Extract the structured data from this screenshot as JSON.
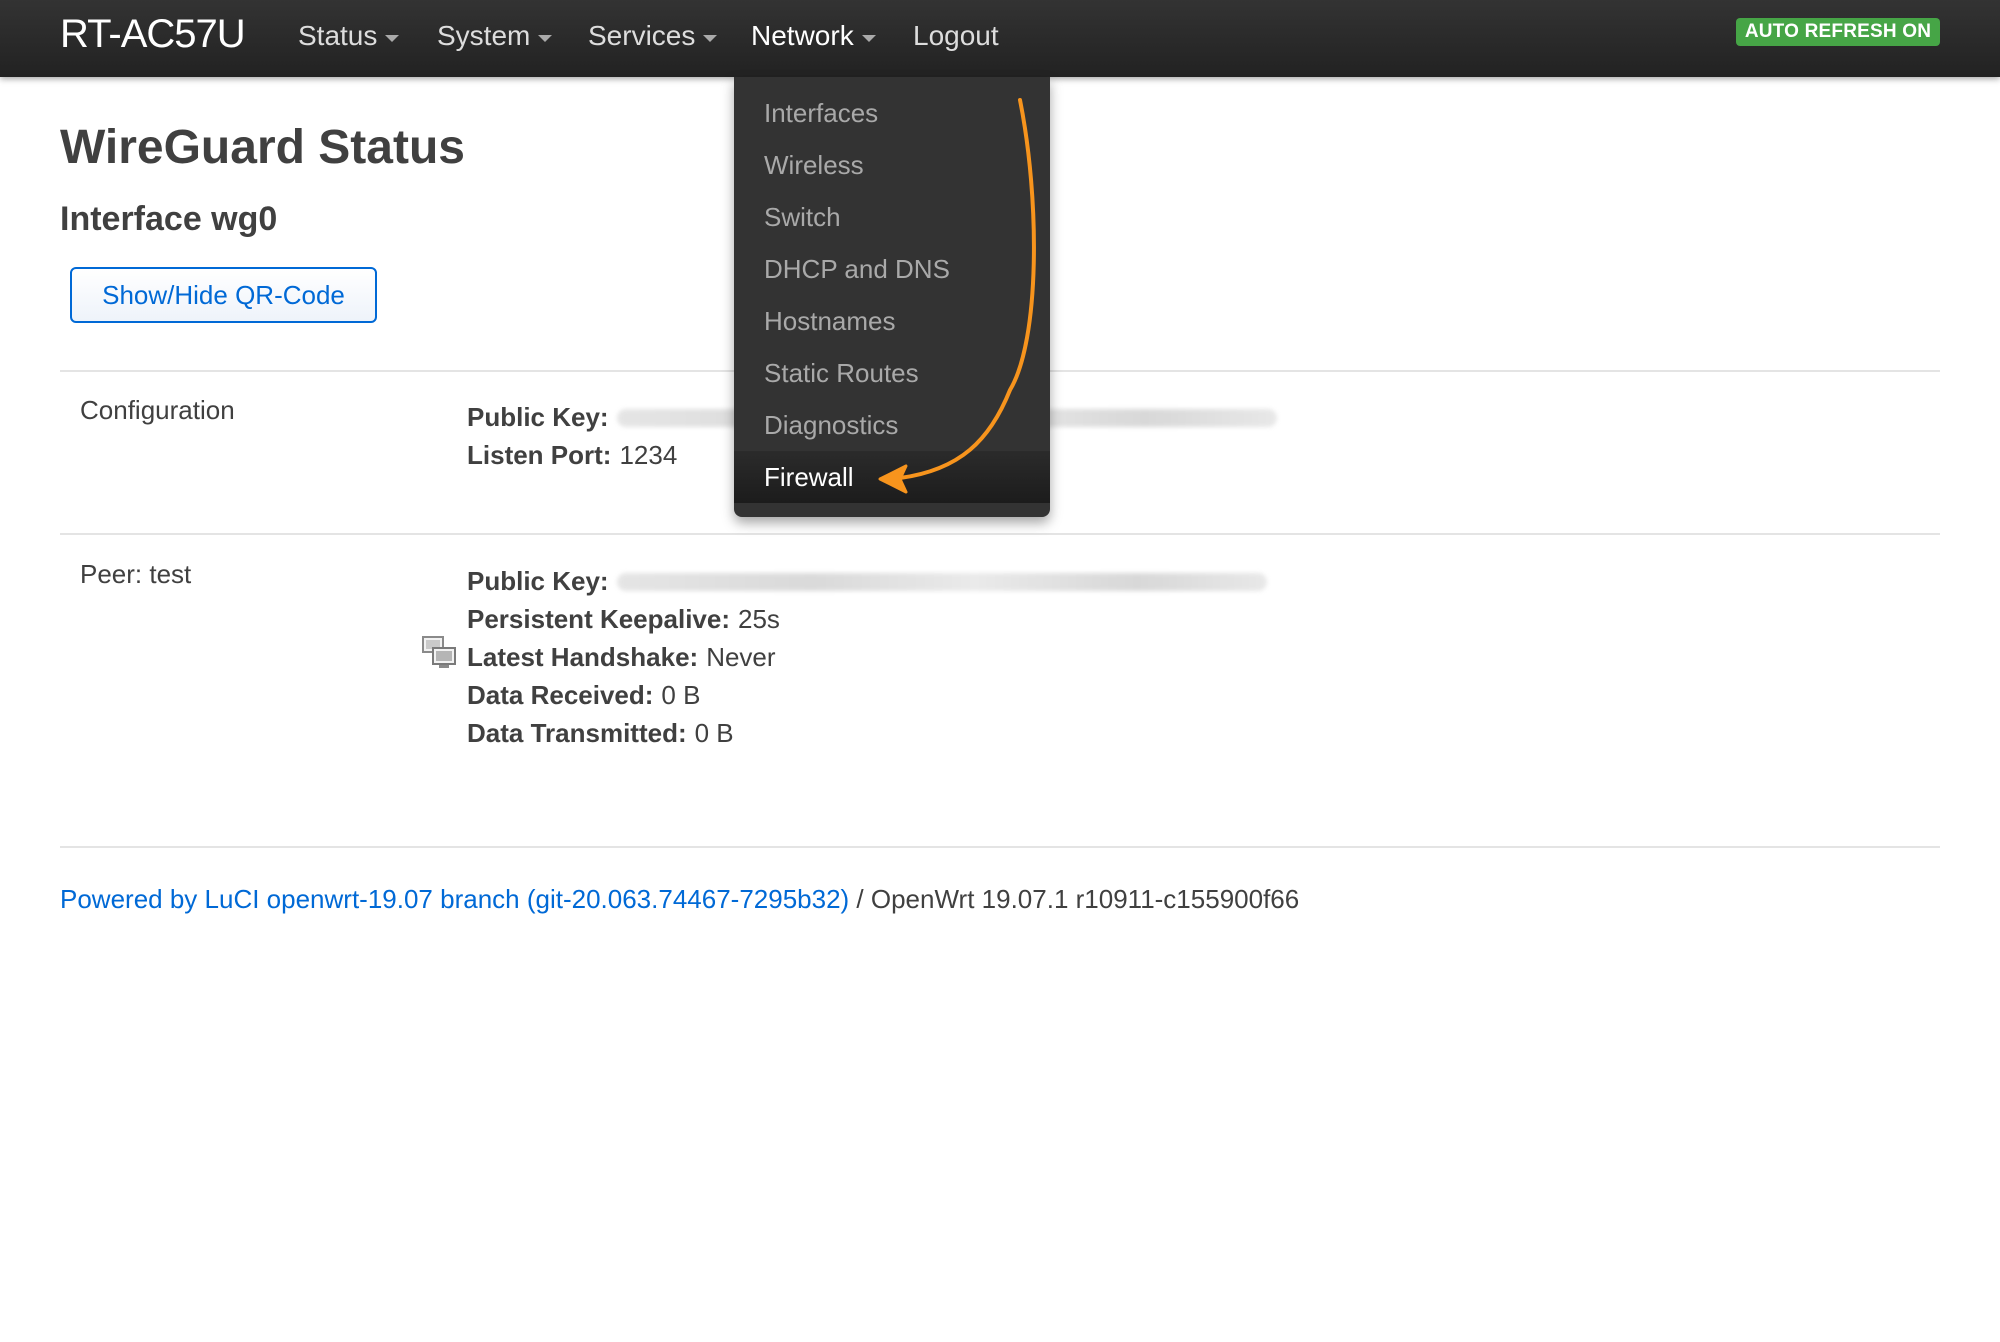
{
  "navbar": {
    "brand": "RT-AC57U",
    "items": [
      {
        "label": "Status",
        "has_caret": true
      },
      {
        "label": "System",
        "has_caret": true
      },
      {
        "label": "Services",
        "has_caret": true
      },
      {
        "label": "Network",
        "has_caret": true
      },
      {
        "label": "Logout",
        "has_caret": false
      }
    ],
    "auto_refresh_badge": "AUTO REFRESH ON",
    "badge_color": "#46a546"
  },
  "network_menu": {
    "items": [
      {
        "label": "Interfaces"
      },
      {
        "label": "Wireless"
      },
      {
        "label": "Switch"
      },
      {
        "label": "DHCP and DNS"
      },
      {
        "label": "Hostnames"
      },
      {
        "label": "Static Routes"
      },
      {
        "label": "Diagnostics"
      },
      {
        "label": "Firewall",
        "active": true
      }
    ],
    "annotation_arrow_color": "#f7941d"
  },
  "main": {
    "page_title": "WireGuard Status",
    "interface_title": "Interface wg0",
    "qr_button_label": "Show/Hide QR-Code",
    "configuration": {
      "label": "Configuration",
      "public_key_label": "Public Key:",
      "listen_port_label": "Listen Port:",
      "listen_port_value": "1234"
    },
    "peer": {
      "label": "Peer: test",
      "public_key_label": "Public Key:",
      "keepalive_label": "Persistent Keepalive:",
      "keepalive_value": "25s",
      "handshake_label": "Latest Handshake:",
      "handshake_value": "Never",
      "received_label": "Data Received:",
      "received_value": "0 B",
      "transmitted_label": "Data Transmitted:",
      "transmitted_value": "0 B"
    }
  },
  "footer": {
    "link_text": "Powered by LuCI openwrt-19.07 branch (git-20.063.74467-7295b32)",
    "version_text": " / OpenWrt 19.07.1 r10911-c155900f66"
  },
  "colors": {
    "link": "#0069d6",
    "navbar_bg": "#2a2a2a",
    "text": "#404040"
  }
}
